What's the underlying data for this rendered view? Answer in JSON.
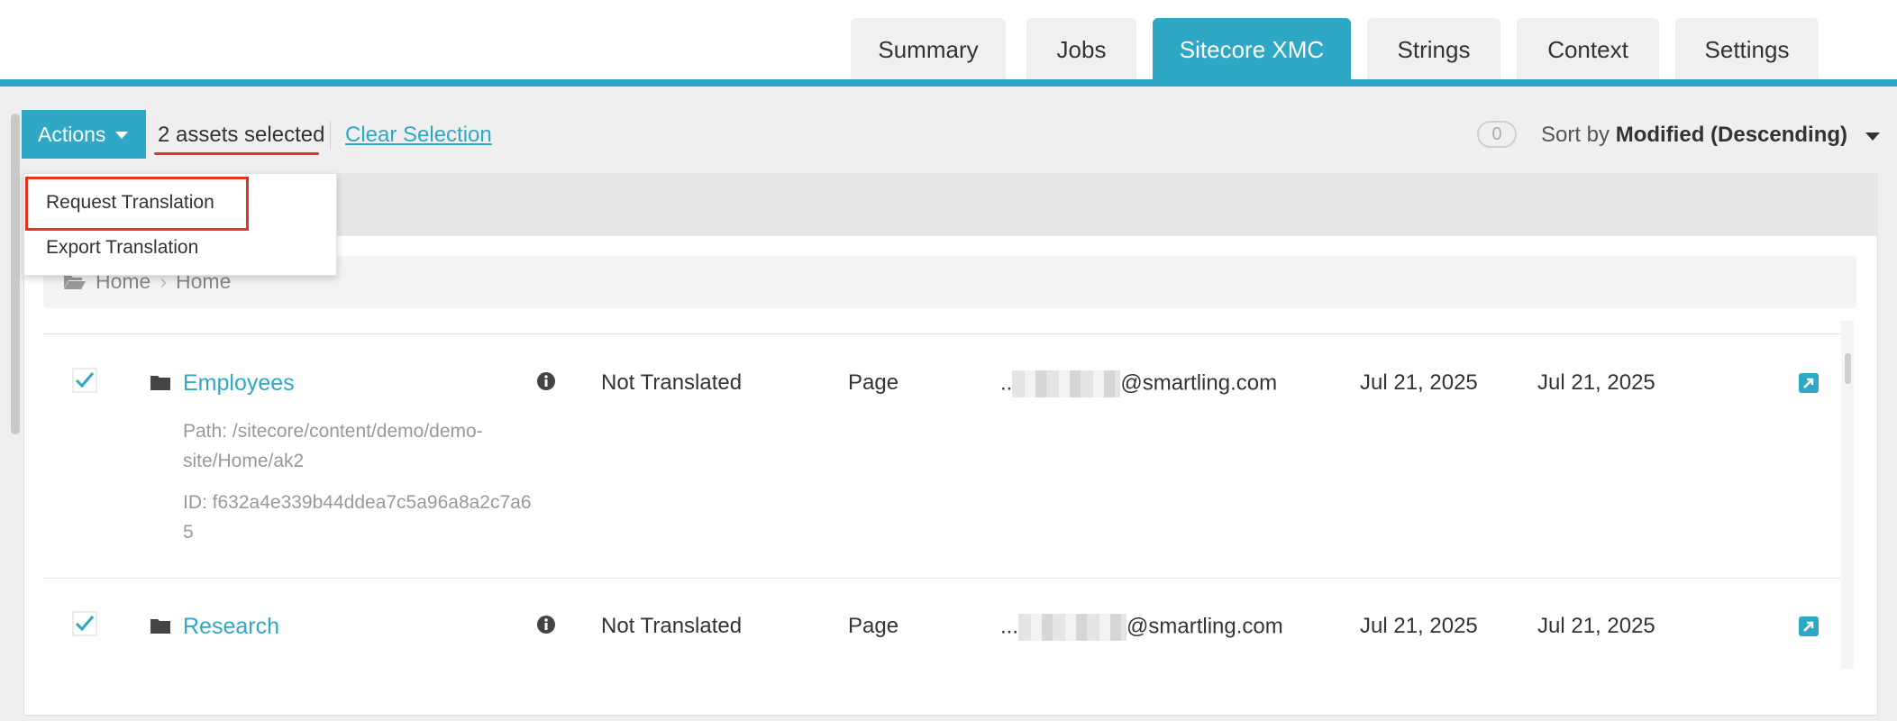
{
  "tabs": [
    "Summary",
    "Jobs",
    "Sitecore XMC",
    "Strings",
    "Context",
    "Settings"
  ],
  "toolbar": {
    "actions_label": "Actions",
    "selection_text": "2 assets selected",
    "clear_selection": "Clear Selection",
    "count": "0",
    "sort_prefix": "Sort by",
    "sort_value": "Modified (Descending)"
  },
  "actions_menu": {
    "items": [
      "Request Translation",
      "Export Translation"
    ]
  },
  "breadcrumb": [
    "Home",
    "Home"
  ],
  "rows": [
    {
      "name": "Employees",
      "path": "Path: /sitecore/content/demo/demo-site/Home/ak2",
      "id": "ID: f632a4e339b44ddea7c5a96a8a2c7a65",
      "status": "Not Translated",
      "type": "Page",
      "author_prefix": "..",
      "author_suffix": "@smartling.com",
      "created": "Jul 21, 2025",
      "modified": "Jul 21, 2025"
    },
    {
      "name": "Research",
      "status": "Not Translated",
      "type": "Page",
      "author_prefix": "...",
      "author_suffix": "@smartling.com",
      "created": "Jul 21, 2025",
      "modified": "Jul 21, 2025"
    }
  ],
  "colors": {
    "accent": "#2fa8c5",
    "highlight": "#e53421"
  }
}
